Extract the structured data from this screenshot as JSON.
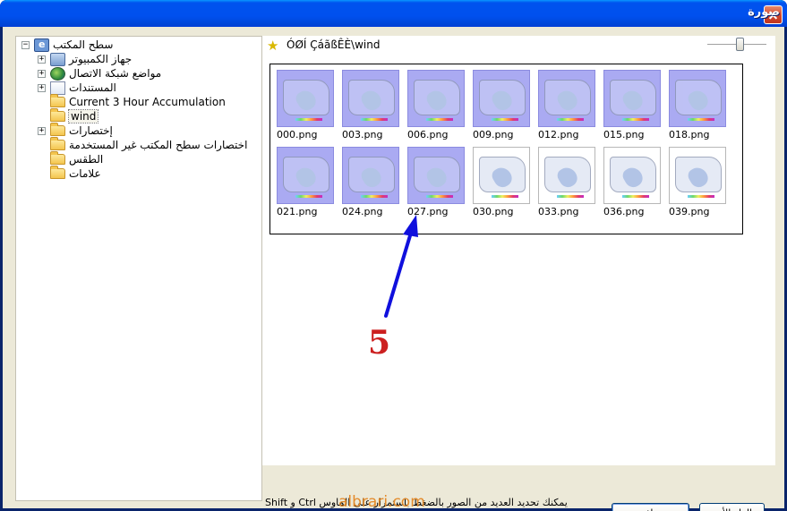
{
  "window": {
    "title": "صورة"
  },
  "tree": {
    "root": "سطح المكتب",
    "items": [
      {
        "label": "جهاز الكمبيوتر",
        "icon": "computer-icon",
        "expandable": true
      },
      {
        "label": "مواضع شبكة الاتصال",
        "icon": "network-icon",
        "expandable": true
      },
      {
        "label": "المستندات",
        "icon": "documents-icon",
        "expandable": true
      },
      {
        "label": "Current 3 Hour Accumulation",
        "icon": "folder-icon",
        "expandable": false
      },
      {
        "label": "wind",
        "icon": "folder-icon",
        "expandable": false,
        "selected": true
      },
      {
        "label": "إختصارات",
        "icon": "folder-icon",
        "expandable": true
      },
      {
        "label": "اختصارات سطح المكتب غير المستخدمة",
        "icon": "folder-icon",
        "expandable": false
      },
      {
        "label": "الطقس",
        "icon": "folder-icon",
        "expandable": false
      },
      {
        "label": "علامات",
        "icon": "folder-icon",
        "expandable": false
      }
    ]
  },
  "pathbar": {
    "path": "ÓØÍ ÇáãßÊÈ\\wind",
    "icon": "star-icon"
  },
  "thumbnails": [
    {
      "name": "000.png",
      "selected": true
    },
    {
      "name": "003.png",
      "selected": true
    },
    {
      "name": "006.png",
      "selected": true
    },
    {
      "name": "009.png",
      "selected": true
    },
    {
      "name": "012.png",
      "selected": true
    },
    {
      "name": "015.png",
      "selected": true
    },
    {
      "name": "018.png",
      "selected": true
    },
    {
      "name": "021.png",
      "selected": true
    },
    {
      "name": "024.png",
      "selected": true
    },
    {
      "name": "027.png",
      "selected": true
    },
    {
      "name": "030.png",
      "selected": false
    },
    {
      "name": "033.png",
      "selected": false
    },
    {
      "name": "036.png",
      "selected": false
    },
    {
      "name": "039.png",
      "selected": false
    }
  ],
  "annotation": {
    "step_number": "5",
    "arrow_color": "#1010dd",
    "number_color": "#cc2020"
  },
  "hint": "يمكنك تحديد العديد من الصور بالضغط باستمرار على الماوس Ctrl و Shift",
  "buttons": {
    "ok": "موافق",
    "cancel": "إلغاء الأمر"
  },
  "watermark": "albrari.com",
  "colors": {
    "title_bar": "#0053ee",
    "selection": "#aaaaf2"
  }
}
